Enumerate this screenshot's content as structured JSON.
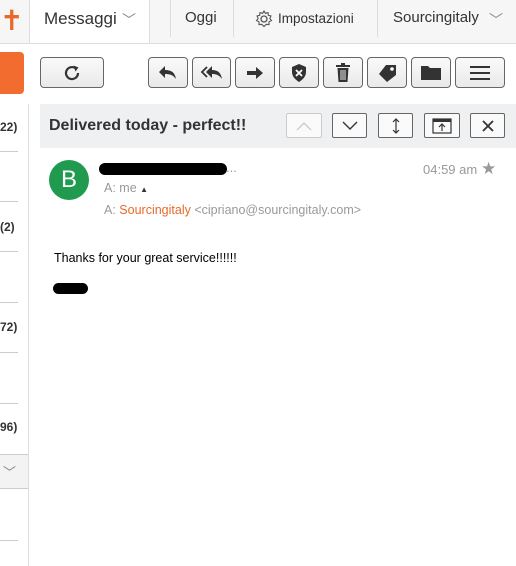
{
  "topbar": {
    "tabs": [
      {
        "label": "Messaggi"
      },
      {
        "label": "Oggi"
      },
      {
        "label": "Impostazioni"
      },
      {
        "label": "Sourcingitaly"
      }
    ]
  },
  "toolbar": {
    "icons": [
      "refresh-icon",
      "reply-icon",
      "reply-all-icon",
      "forward-icon",
      "spam-shield-icon",
      "trash-icon",
      "tag-icon",
      "folder-icon",
      "menu-icon"
    ]
  },
  "folders": {
    "counts": [
      "22)",
      "(2)",
      "72)",
      "96)"
    ]
  },
  "message": {
    "subject": "Delivered today - perfect!!",
    "avatar_letter": "B",
    "sender_tail": "...",
    "time": "04:59 am",
    "to_label": "A:",
    "to_me": "me",
    "to_org": "Sourcingitaly",
    "to_email": "<cipriano@sourcingitaly.com>",
    "body": "Thanks for your great service!!!!!!"
  },
  "colors": {
    "accent": "#f26b2f",
    "avatar": "#1f9a4f",
    "header_bg": "#eef0f1"
  }
}
